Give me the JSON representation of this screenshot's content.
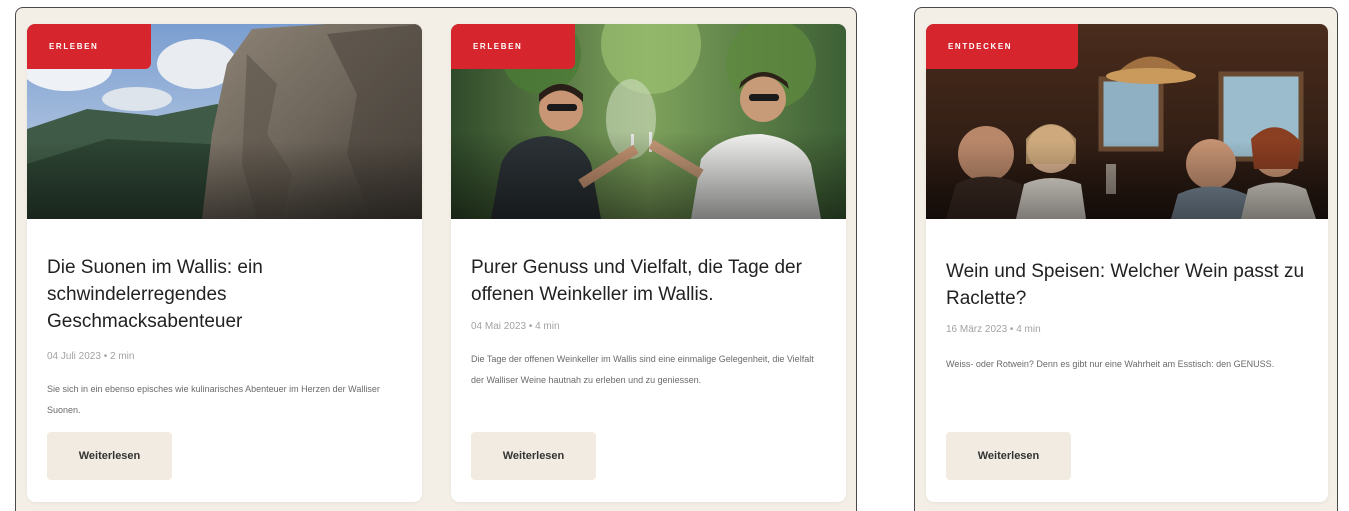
{
  "cards": [
    {
      "badge": "ERLEBEN",
      "title": "Die Suonen im Wallis: ein schwindelerregendes Geschmacksabenteuer",
      "meta": "04 Juli 2023 • 2 min",
      "excerpt": "Sie sich in ein ebenso episches wie kulinarisches Abenteuer im Herzen der Walliser Suonen.",
      "button": "Weiterlesen"
    },
    {
      "badge": "ERLEBEN",
      "title": "Purer Genuss und Vielfalt, die Tage der offenen Weinkeller im Wallis.",
      "meta": "04 Mai 2023 • 4 min",
      "excerpt": "Die Tage der offenen Weinkeller im Wallis sind eine einmalige Gelegenheit, die Vielfalt der Walliser Weine hautnah zu erleben und zu geniessen.",
      "button": "Weiterlesen"
    },
    {
      "badge": "ENTDECKEN",
      "title": "Wein und Speisen: Welcher Wein passt zu Raclette?",
      "meta": "16 März 2023 • 4 min",
      "excerpt": "Weiss- oder Rotwein? Denn es gibt nur eine Wahrheit am Esstisch: den GENUSS.",
      "button": "Weiterlesen"
    }
  ],
  "colors": {
    "badge": "#d7252d",
    "panel": "#f3eee6",
    "button": "#f1ebe2"
  }
}
